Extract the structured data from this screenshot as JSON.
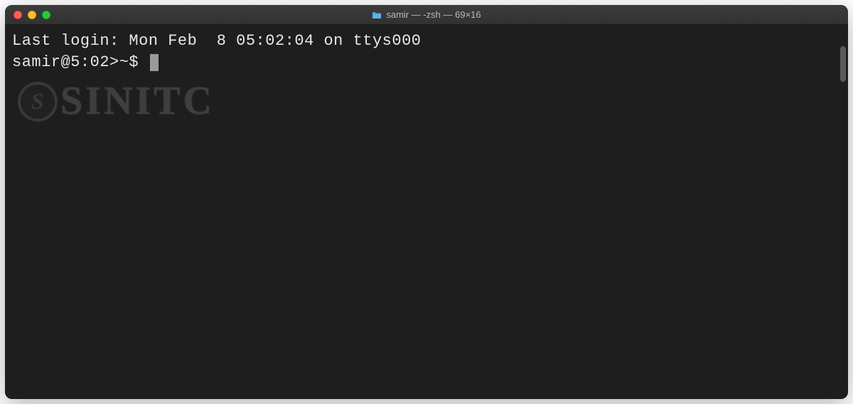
{
  "window": {
    "title": "samir — -zsh — 69×16"
  },
  "terminal": {
    "last_login": "Last login: Mon Feb  8 05:02:04 on ttys000",
    "prompt": "samir@5:02>~$ "
  },
  "watermark": {
    "logo_letter": "S",
    "text": "SINITC"
  }
}
